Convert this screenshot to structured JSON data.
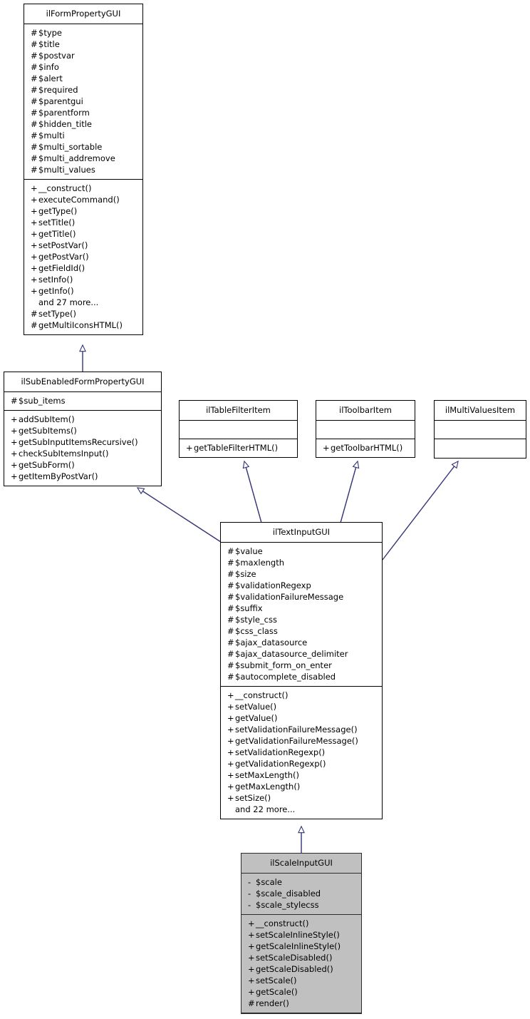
{
  "diagram": {
    "type": "uml-class-diagram",
    "title": "ilScaleInputGUI inheritance diagram",
    "relationship_type": "generalization",
    "line_color": "#343477",
    "highlight_fill": "#c0c0c0",
    "box_fill": "#ffffff",
    "border_color": "#000000"
  },
  "classes": {
    "ilFormPropertyGUI": {
      "name": "ilFormPropertyGUI",
      "highlighted": false,
      "attributes": [
        {
          "visibility": "#",
          "label": "$type"
        },
        {
          "visibility": "#",
          "label": "$title"
        },
        {
          "visibility": "#",
          "label": "$postvar"
        },
        {
          "visibility": "#",
          "label": "$info"
        },
        {
          "visibility": "#",
          "label": "$alert"
        },
        {
          "visibility": "#",
          "label": "$required"
        },
        {
          "visibility": "#",
          "label": "$parentgui"
        },
        {
          "visibility": "#",
          "label": "$parentform"
        },
        {
          "visibility": "#",
          "label": "$hidden_title"
        },
        {
          "visibility": "#",
          "label": "$multi"
        },
        {
          "visibility": "#",
          "label": "$multi_sortable"
        },
        {
          "visibility": "#",
          "label": "$multi_addremove"
        },
        {
          "visibility": "#",
          "label": "$multi_values"
        }
      ],
      "operations": [
        {
          "visibility": "+",
          "label": "__construct()"
        },
        {
          "visibility": "+",
          "label": "executeCommand()"
        },
        {
          "visibility": "+",
          "label": "getType()"
        },
        {
          "visibility": "+",
          "label": "setTitle()"
        },
        {
          "visibility": "+",
          "label": "getTitle()"
        },
        {
          "visibility": "+",
          "label": "setPostVar()"
        },
        {
          "visibility": "+",
          "label": "getPostVar()"
        },
        {
          "visibility": "+",
          "label": "getFieldId()"
        },
        {
          "visibility": "+",
          "label": "setInfo()"
        },
        {
          "visibility": "+",
          "label": "getInfo()"
        },
        {
          "visibility": "",
          "label": "and 27 more..."
        },
        {
          "visibility": "#",
          "label": "setType()"
        },
        {
          "visibility": "#",
          "label": "getMultiIconsHTML()"
        }
      ]
    },
    "ilSubEnabledFormPropertyGUI": {
      "name": "ilSubEnabledFormPropertyGUI",
      "highlighted": false,
      "attributes": [
        {
          "visibility": "#",
          "label": "$sub_items"
        }
      ],
      "operations": [
        {
          "visibility": "+",
          "label": "addSubItem()"
        },
        {
          "visibility": "+",
          "label": "getSubItems()"
        },
        {
          "visibility": "+",
          "label": "getSubInputItemsRecursive()"
        },
        {
          "visibility": "+",
          "label": "checkSubItemsInput()"
        },
        {
          "visibility": "+",
          "label": "getSubForm()"
        },
        {
          "visibility": "+",
          "label": "getItemByPostVar()"
        }
      ]
    },
    "ilTableFilterItem": {
      "name": "ilTableFilterItem",
      "highlighted": false,
      "attributes": [],
      "operations": [
        {
          "visibility": "+",
          "label": "getTableFilterHTML()"
        }
      ]
    },
    "ilToolbarItem": {
      "name": "ilToolbarItem",
      "highlighted": false,
      "attributes": [],
      "operations": [
        {
          "visibility": "+",
          "label": "getToolbarHTML()"
        }
      ]
    },
    "ilMultiValuesItem": {
      "name": "ilMultiValuesItem",
      "highlighted": false,
      "attributes": [],
      "operations": []
    },
    "ilTextInputGUI": {
      "name": "ilTextInputGUI",
      "highlighted": false,
      "attributes": [
        {
          "visibility": "#",
          "label": "$value"
        },
        {
          "visibility": "#",
          "label": "$maxlength"
        },
        {
          "visibility": "#",
          "label": "$size"
        },
        {
          "visibility": "#",
          "label": "$validationRegexp"
        },
        {
          "visibility": "#",
          "label": "$validationFailureMessage"
        },
        {
          "visibility": "#",
          "label": "$suffix"
        },
        {
          "visibility": "#",
          "label": "$style_css"
        },
        {
          "visibility": "#",
          "label": "$css_class"
        },
        {
          "visibility": "#",
          "label": "$ajax_datasource"
        },
        {
          "visibility": "#",
          "label": "$ajax_datasource_delimiter"
        },
        {
          "visibility": "#",
          "label": "$submit_form_on_enter"
        },
        {
          "visibility": "#",
          "label": "$autocomplete_disabled"
        }
      ],
      "operations": [
        {
          "visibility": "+",
          "label": "__construct()"
        },
        {
          "visibility": "+",
          "label": "setValue()"
        },
        {
          "visibility": "+",
          "label": "getValue()"
        },
        {
          "visibility": "+",
          "label": "setValidationFailureMessage()"
        },
        {
          "visibility": "+",
          "label": "getValidationFailureMessage()"
        },
        {
          "visibility": "+",
          "label": "setValidationRegexp()"
        },
        {
          "visibility": "+",
          "label": "getValidationRegexp()"
        },
        {
          "visibility": "+",
          "label": "setMaxLength()"
        },
        {
          "visibility": "+",
          "label": "getMaxLength()"
        },
        {
          "visibility": "+",
          "label": "setSize()"
        },
        {
          "visibility": "",
          "label": "and 22 more..."
        }
      ]
    },
    "ilScaleInputGUI": {
      "name": "ilScaleInputGUI",
      "highlighted": true,
      "attributes": [
        {
          "visibility": "-",
          "label": "$scale"
        },
        {
          "visibility": "-",
          "label": "$scale_disabled"
        },
        {
          "visibility": "-",
          "label": "$scale_stylecss"
        }
      ],
      "operations": [
        {
          "visibility": "+",
          "label": "__construct()"
        },
        {
          "visibility": "+",
          "label": "setScaleInlineStyle()"
        },
        {
          "visibility": "+",
          "label": "getScaleInlineStyle()"
        },
        {
          "visibility": "+",
          "label": "setScaleDisabled()"
        },
        {
          "visibility": "+",
          "label": "getScaleDisabled()"
        },
        {
          "visibility": "+",
          "label": "setScale()"
        },
        {
          "visibility": "+",
          "label": "getScale()"
        },
        {
          "visibility": "#",
          "label": "render()"
        }
      ]
    }
  },
  "relationships": [
    {
      "from": "ilSubEnabledFormPropertyGUI",
      "to": "ilFormPropertyGUI",
      "kind": "inherits"
    },
    {
      "from": "ilTextInputGUI",
      "to": "ilSubEnabledFormPropertyGUI",
      "kind": "inherits"
    },
    {
      "from": "ilTextInputGUI",
      "to": "ilTableFilterItem",
      "kind": "implements"
    },
    {
      "from": "ilTextInputGUI",
      "to": "ilToolbarItem",
      "kind": "implements"
    },
    {
      "from": "ilTextInputGUI",
      "to": "ilMultiValuesItem",
      "kind": "implements"
    },
    {
      "from": "ilScaleInputGUI",
      "to": "ilTextInputGUI",
      "kind": "inherits"
    }
  ]
}
